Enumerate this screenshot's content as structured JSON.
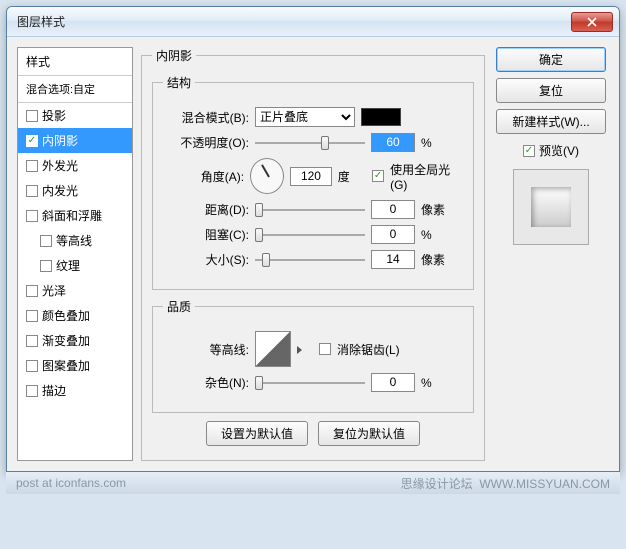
{
  "window": {
    "title": "图层样式"
  },
  "sidebar": {
    "header": "样式",
    "subheader": "混合选项:自定",
    "items": [
      {
        "label": "投影",
        "checked": false,
        "selected": false,
        "indent": false
      },
      {
        "label": "内阴影",
        "checked": true,
        "selected": true,
        "indent": false
      },
      {
        "label": "外发光",
        "checked": false,
        "selected": false,
        "indent": false
      },
      {
        "label": "内发光",
        "checked": false,
        "selected": false,
        "indent": false
      },
      {
        "label": "斜面和浮雕",
        "checked": false,
        "selected": false,
        "indent": false
      },
      {
        "label": "等高线",
        "checked": false,
        "selected": false,
        "indent": true
      },
      {
        "label": "纹理",
        "checked": false,
        "selected": false,
        "indent": true
      },
      {
        "label": "光泽",
        "checked": false,
        "selected": false,
        "indent": false
      },
      {
        "label": "颜色叠加",
        "checked": false,
        "selected": false,
        "indent": false
      },
      {
        "label": "渐变叠加",
        "checked": false,
        "selected": false,
        "indent": false
      },
      {
        "label": "图案叠加",
        "checked": false,
        "selected": false,
        "indent": false
      },
      {
        "label": "描边",
        "checked": false,
        "selected": false,
        "indent": false
      }
    ]
  },
  "panel": {
    "title": "内阴影",
    "structure": {
      "legend": "结构",
      "blend_label": "混合模式(B):",
      "blend_value": "正片叠底",
      "blend_color": "#000000",
      "opacity_label": "不透明度(O):",
      "opacity_value": "60",
      "opacity_unit": "%",
      "angle_label": "角度(A):",
      "angle_value": "120",
      "angle_unit": "度",
      "global_light": "使用全局光(G)",
      "global_light_checked": true,
      "distance_label": "距离(D):",
      "distance_value": "0",
      "distance_unit": "像素",
      "choke_label": "阻塞(C):",
      "choke_value": "0",
      "choke_unit": "%",
      "size_label": "大小(S):",
      "size_value": "14",
      "size_unit": "像素"
    },
    "quality": {
      "legend": "品质",
      "contour_label": "等高线:",
      "antialias": "消除锯齿(L)",
      "antialias_checked": false,
      "noise_label": "杂色(N):",
      "noise_value": "0",
      "noise_unit": "%"
    },
    "set_default": "设置为默认值",
    "reset_default": "复位为默认值"
  },
  "right": {
    "ok": "确定",
    "cancel": "复位",
    "newstyle": "新建样式(W)...",
    "preview": "预览(V)",
    "preview_checked": true
  },
  "footer": {
    "left": "post at iconfans.com",
    "right_cn": "思缘设计论坛",
    "right_url": "WWW.MISSYUAN.COM"
  }
}
